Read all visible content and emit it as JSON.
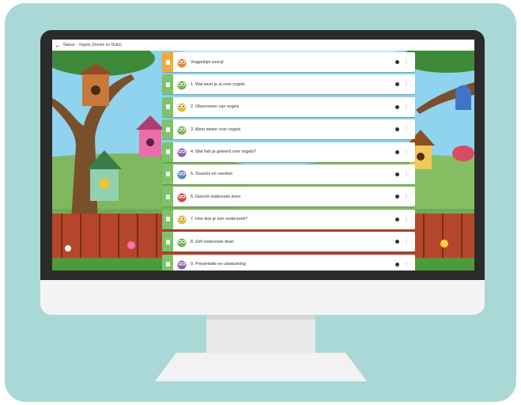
{
  "header": {
    "back_icon": "arrow-left-icon",
    "breadcrumb": "Natuur - Vogels (Drents en Duits)"
  },
  "colors": {
    "orange_tab": "#f0a93b",
    "green_tab": "#7cc36a"
  },
  "lessons": [
    {
      "label": "Vragenlijst vooraf",
      "tab_color": "orange",
      "owl": "orange"
    },
    {
      "label": "1. Wat weet je al over vogels",
      "tab_color": "green",
      "owl": "green"
    },
    {
      "label": "2. Observeren van vogels",
      "tab_color": "green",
      "owl": "yellow"
    },
    {
      "label": "3. Meer weten over vogels",
      "tab_color": "green",
      "owl": "green"
    },
    {
      "label": "4. Wat heb je geleerd over vogels?",
      "tab_color": "green",
      "owl": "purple"
    },
    {
      "label": "5. Snavels en voedsel",
      "tab_color": "green",
      "owl": "blue"
    },
    {
      "label": "6. Gericht onderzoek doen",
      "tab_color": "green",
      "owl": "red"
    },
    {
      "label": "7. Hoe doe je een onderzoek?",
      "tab_color": "green",
      "owl": "yellow"
    },
    {
      "label": "8. Zelf onderzoek doen",
      "tab_color": "green",
      "owl": "green"
    },
    {
      "label": "9. Presentatie en uitwisseling",
      "tab_color": "green",
      "owl": "purple"
    }
  ]
}
